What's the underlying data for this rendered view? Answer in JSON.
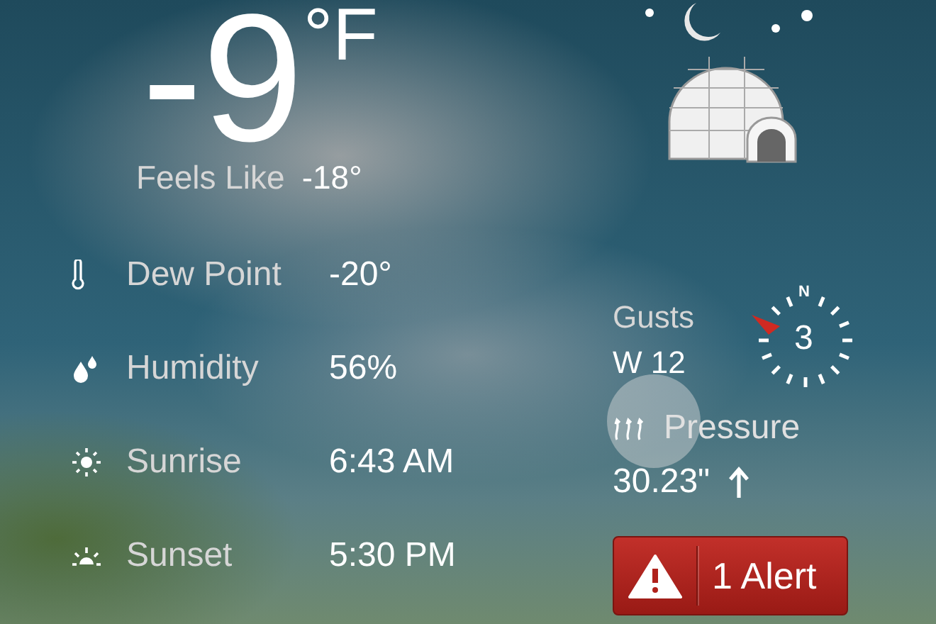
{
  "temperature": {
    "value": "-9",
    "unit": "°F"
  },
  "feels_like": {
    "label": "Feels Like",
    "value": "-18°"
  },
  "details": [
    {
      "kind": "dew_point",
      "label": "Dew Point",
      "value": "-20°"
    },
    {
      "kind": "humidity",
      "label": "Humidity",
      "value": "56%"
    },
    {
      "kind": "sunrise",
      "label": "Sunrise",
      "value": "6:43 AM"
    },
    {
      "kind": "sunset",
      "label": "Sunset",
      "value": "5:30 PM"
    }
  ],
  "wind": {
    "label": "Gusts",
    "value": "W 12",
    "compass_label": "N",
    "speed": "3"
  },
  "pressure": {
    "label": "Pressure",
    "value": "30.23\""
  },
  "alert": {
    "label": "1 Alert"
  }
}
